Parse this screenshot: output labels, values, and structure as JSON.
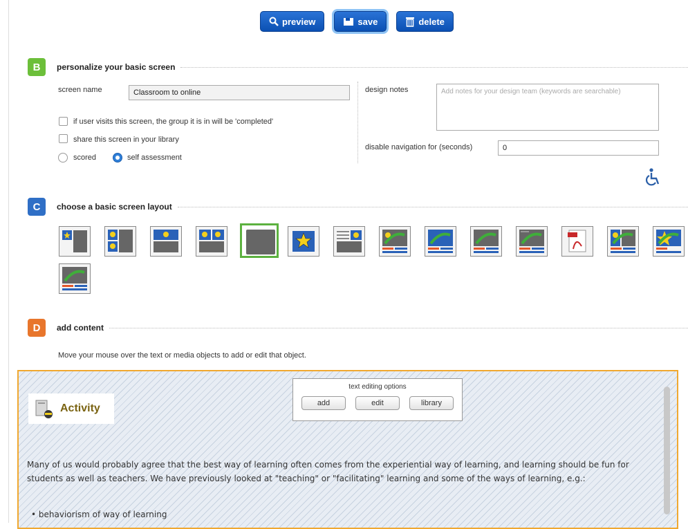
{
  "toolbar": {
    "preview_label": "preview",
    "save_label": "save",
    "delete_label": "delete"
  },
  "sectionB": {
    "badge": "B",
    "title": "personalize your basic screen",
    "screen_name_label": "screen name",
    "screen_name_value": "Classroom to online",
    "checkbox_completed": "if user visits this screen, the group it is in will be 'completed'",
    "checkbox_share": "share this screen in your library",
    "radio_scored": "scored",
    "radio_self": "self assessment",
    "design_notes_label": "design notes",
    "design_notes_placeholder": "Add notes for your design team (keywords are searchable)",
    "disable_nav_label": "disable navigation for (seconds)",
    "disable_nav_value": "0"
  },
  "sectionC": {
    "badge": "C",
    "title": "choose a basic screen layout"
  },
  "sectionD": {
    "badge": "D",
    "title": "add content",
    "hint": "Move your mouse over the text or media objects to add or edit that object."
  },
  "editor": {
    "options_title": "text editing options",
    "add_label": "add",
    "edit_label": "edit",
    "library_label": "library",
    "activity_title": "Activity",
    "paragraph": "Many of us would probably agree that the best way of learning often comes from the experiential way of learning, and learning should be fun for students as well as teachers. We have previously looked at \"teaching\" or \"facilitating\" learning and some of the ways of learning, e.g.:",
    "bullet_1": "behaviorism of way of learning"
  },
  "colors": {
    "badge_b": "#6cbf3a",
    "badge_c": "#2f6fc6",
    "badge_d": "#e8762c",
    "accent": "#0b5ac2",
    "content_border": "#f0a830"
  }
}
